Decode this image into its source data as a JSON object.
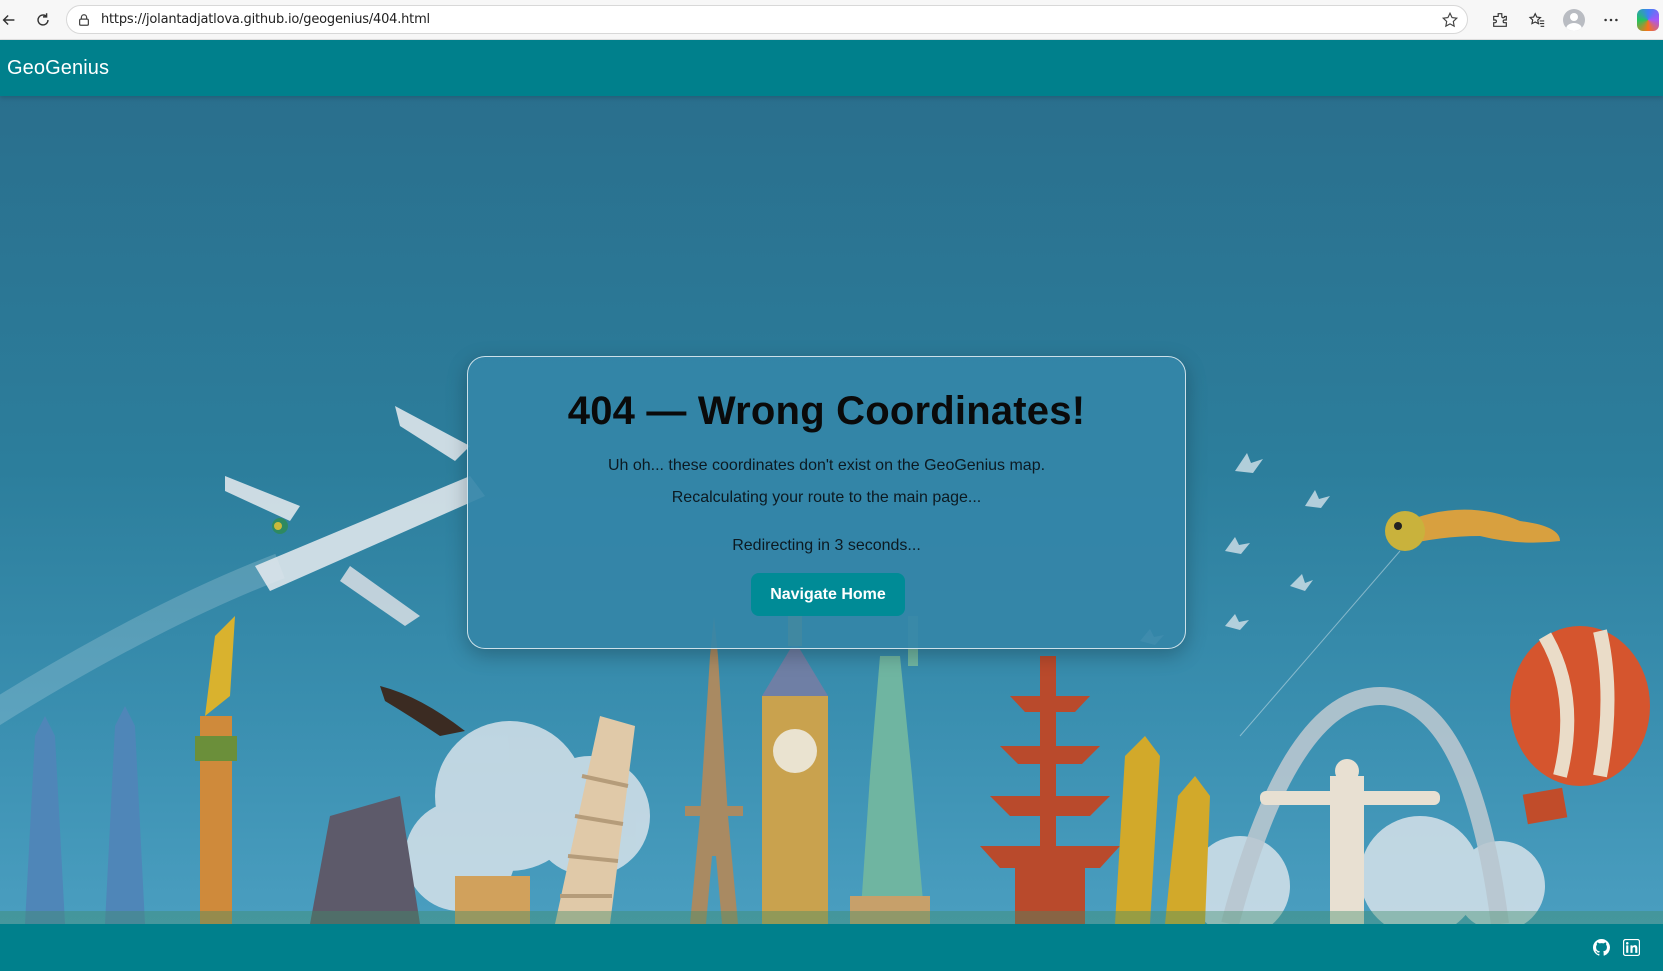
{
  "browser": {
    "url": "https://jolantadjatlova.github.io/geogenius/404.html",
    "icons": [
      "back-arrow-icon",
      "reload-icon",
      "lock-icon",
      "star-icon",
      "extensions-icon",
      "favorites-icon",
      "profile-icon",
      "more-icon",
      "copilot-icon"
    ]
  },
  "header": {
    "brand": "GeoGenius"
  },
  "error_card": {
    "title": "404 — Wrong Coordinates!",
    "message_1": "Uh oh... these coordinates don't exist on the GeoGenius map.",
    "message_2": "Recalculating your route to the main page...",
    "redirect_text": "Redirecting in 3 seconds...",
    "button_label": "Navigate Home"
  },
  "footer": {
    "icons": [
      "github-icon",
      "linkedin-icon"
    ]
  },
  "colors": {
    "teal_header": "#00808c",
    "card_bg": "#3485a8",
    "button": "#008b96",
    "sky": "#2c7e9c"
  }
}
